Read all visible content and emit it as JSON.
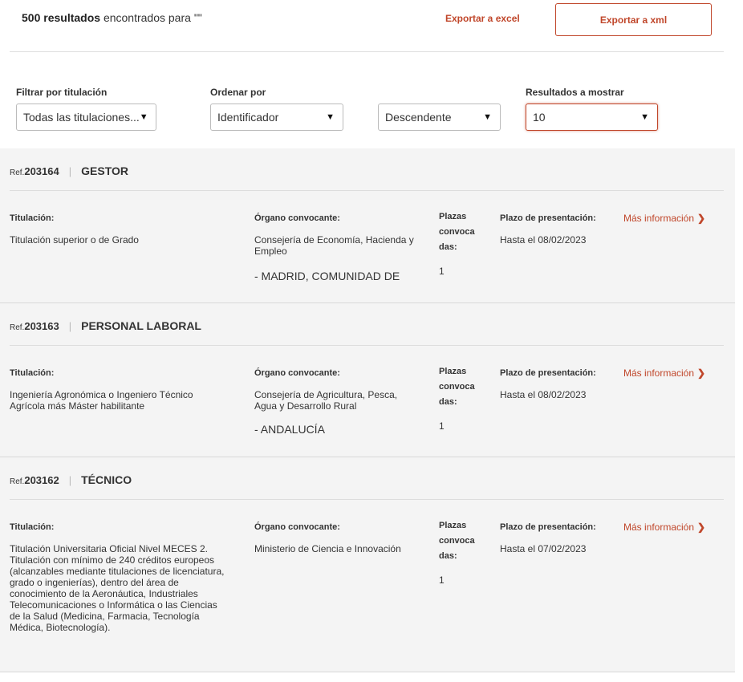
{
  "header": {
    "result_count": "500 resultados",
    "found_text": " encontrados para ",
    "query": "\"\"",
    "export_excel": "Exportar a excel",
    "export_xml": "Exportar a xml"
  },
  "filters": {
    "titulacion_label": "Filtrar por titulación",
    "titulacion_value": "Todas las titulaciones...",
    "ordenar_label": "Ordenar por",
    "ordenar_value": "Identificador",
    "direccion_value": "Descendente",
    "resultados_label": "Resultados a mostrar",
    "resultados_value": "10",
    "arrow": "▼"
  },
  "labels": {
    "ref_prefix": "Ref.",
    "titulacion": "Titulación:",
    "organo": "Órgano convocante:",
    "plazas": "Plazas convoca das:",
    "plazo": "Plazo de presentación:",
    "mas_info": "Más información",
    "chevron": "❯"
  },
  "results": [
    {
      "ref": "203164",
      "title": "GESTOR",
      "titulacion": "Titulación superior o de Grado",
      "organo": "Consejería de Economía, Hacienda y Empleo",
      "region": "- MADRID, COMUNIDAD DE",
      "plazas": "1",
      "plazo": "Hasta el 08/02/2023"
    },
    {
      "ref": "203163",
      "title": "PERSONAL LABORAL",
      "titulacion": "Ingeniería Agronómica o Ingeniero Técnico Agrícola más Máster habilitante",
      "organo": "Consejería de Agricultura, Pesca, Agua y Desarrollo Rural",
      "region": "- ANDALUCÍA",
      "plazas": "1",
      "plazo": "Hasta el 08/02/2023"
    },
    {
      "ref": "203162",
      "title": "TÉCNICO",
      "titulacion": "Titulación Universitaria Oficial Nivel MECES 2. Titulación con mínimo de 240 créditos europeos (alcanzables mediante titulaciones de licenciatura, grado o ingenierías), dentro del área de conocimiento de la Aeronáutica, Industriales Telecomunicaciones o Informática o las Ciencias de la Salud (Medicina, Farmacia, Tecnología Médica, Biotecnología).",
      "organo": "Ministerio de Ciencia e Innovación",
      "region": "",
      "plazas": "1",
      "plazo": "Hasta el 07/02/2023"
    }
  ]
}
